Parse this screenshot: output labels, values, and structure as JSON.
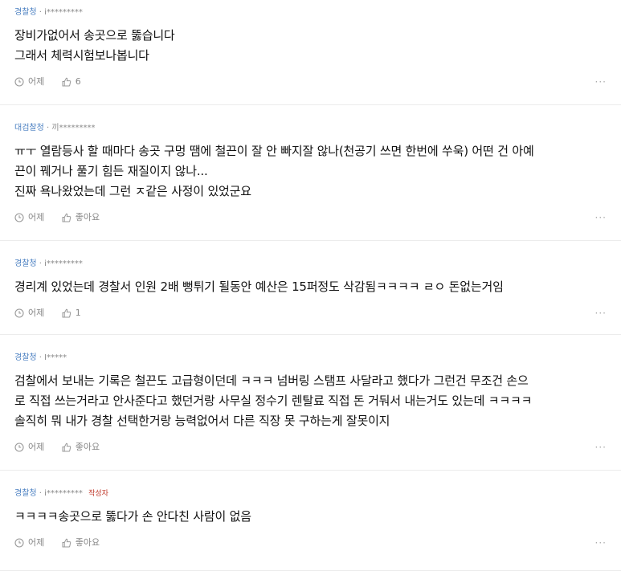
{
  "comments": [
    {
      "org": "경찰청",
      "user": "i*********",
      "lines": [
        "장비가없어서 송곳으로 뚫습니다",
        "그래서 체력시험보나봅니다"
      ],
      "time": "어제",
      "likes": "6",
      "more": "···"
    },
    {
      "org": "대검찰청",
      "user": "끼*********",
      "lines": [
        "ㅠㅜ 열람등사 할 때마다 송곳 구멍 땜에 철끈이 잘 안 빠지잘 않나(천공기 쓰면 한번에 쑤욱) 어떤 건 아예",
        "끈이 꿰거나 풀기 힘든 재질이지 않나...",
        "진짜 욕나왔었는데 그런 ㅈ같은 사정이 있었군요"
      ],
      "time": "어제",
      "likes": "좋아요",
      "more": "···"
    },
    {
      "org": "경찰청",
      "user": "i*********",
      "lines": [
        "경리계 있었는데 경찰서 인원 2배 뻥튀기 될동안 예산은 15퍼정도 삭감됨ㅋㅋㅋㅋ ㄹㅇ 돈없는거임"
      ],
      "time": "어제",
      "likes": "1",
      "more": "···"
    },
    {
      "org": "경찰청",
      "user": "I*****",
      "lines": [
        "검찰에서 보내는 기록은 철끈도 고급형이던데 ㅋㅋㅋ 넘버링 스탬프 사달라고 했다가 그런건 무조건 손으",
        "로 직접 쓰는거라고 안사준다고 했던거랑 사무실 정수기 렌탈료 직접 돈 거둬서 내는거도 있는데 ㅋㅋㅋㅋ",
        "솔직히 뭐 내가 경찰 선택한거랑 능력없어서 다른 직장 못 구하는게 잘못이지"
      ],
      "time": "어제",
      "likes": "좋아요",
      "more": "···"
    },
    {
      "org": "경찰청",
      "user": "i*********",
      "author_tag": "작성자",
      "lines": [
        "ㅋㅋㅋㅋ송곳으로 뚫다가 손 안다친 사람이 없음"
      ],
      "time": "어제",
      "likes": "좋아요",
      "more": "···"
    }
  ]
}
